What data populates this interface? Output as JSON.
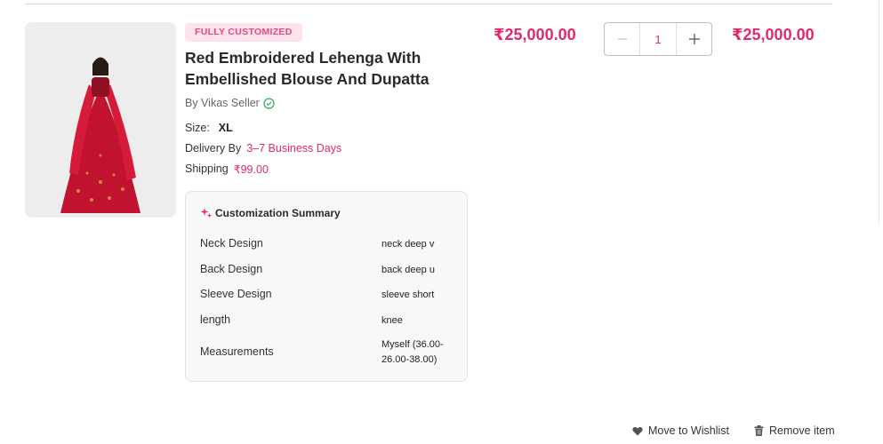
{
  "cart_item": {
    "badge": "FULLY CUSTOMIZED",
    "title": "Red Embroidered Lehenga With Embellished Blouse And Dupatta",
    "seller": "By Vikas Seller",
    "size_label": "Size:",
    "size_value": "XL",
    "delivery_label": "Delivery By",
    "delivery_value": "3–7 Business Days",
    "shipping_label": "Shipping",
    "shipping_value": "₹99.00",
    "unit_price": "₹25,000.00",
    "quantity": "1",
    "total_price": "₹25,000.00"
  },
  "customization": {
    "heading": "Customization Summary",
    "rows": [
      {
        "label": "Neck Design",
        "value": "neck deep v"
      },
      {
        "label": "Back Design",
        "value": "back deep u"
      },
      {
        "label": "Sleeve Design",
        "value": "sleeve short"
      },
      {
        "label": "length",
        "value": "knee"
      },
      {
        "label": "Measurements",
        "value": "Myself (36.00-26.00-38.00)"
      }
    ]
  },
  "actions": {
    "wishlist": "Move to Wishlist",
    "remove": "Remove item"
  },
  "colors": {
    "accent": "#e0296f",
    "badge_bg": "#fde3ee",
    "verified": "#2faa55"
  },
  "icons": [
    "verified-check-icon",
    "sparkle-icon",
    "minus-icon",
    "plus-icon",
    "heart-icon",
    "trash-icon"
  ]
}
